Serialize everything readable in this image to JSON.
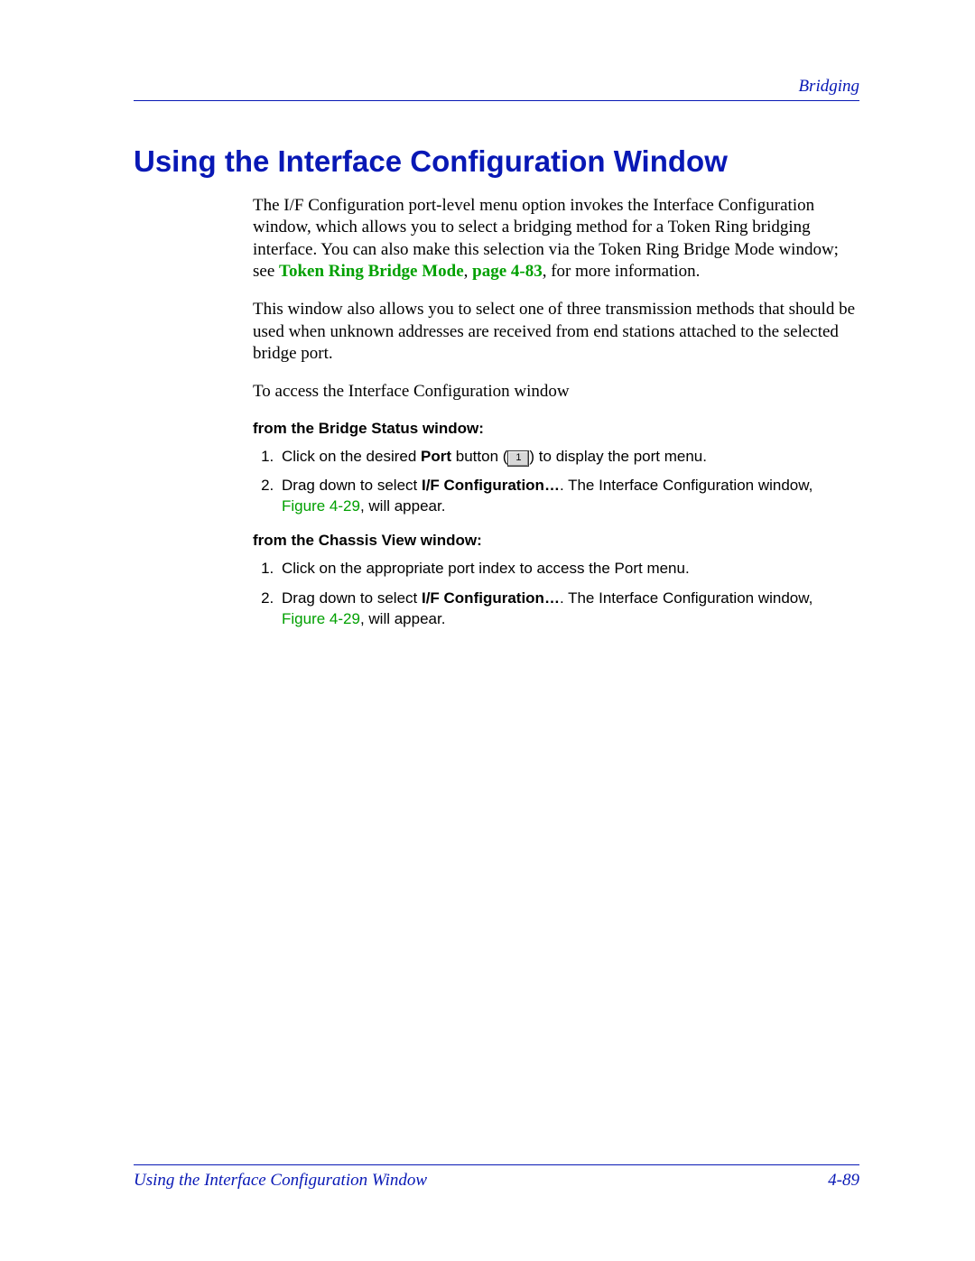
{
  "header": {
    "section_label": "Bridging"
  },
  "title": "Using the Interface Configuration Window",
  "paras": {
    "p1_a": "The I/F Configuration port-level menu option invokes the Interface Configuration window, which allows you to select a bridging method for a Token Ring bridging interface. You can also make this selection via the Token Ring Bridge Mode window; see ",
    "p1_link": "Token Ring Bridge Mode",
    "p1_b": ", ",
    "p1_page": "page 4-83",
    "p1_c": ", for more information.",
    "p2": "This window also allows you to select one of three transmission methods that should be used when unknown addresses are received from end stations attached to the selected bridge port.",
    "p3": "To access the Interface Configuration window"
  },
  "bridge_status": {
    "heading": "from the Bridge Status window:",
    "step1_a": "Click on the desired ",
    "step1_bold": "Port",
    "step1_b": " button (",
    "step1_btn": "1",
    "step1_c": ") to display the port menu.",
    "step2_a": "Drag down to select ",
    "step2_bold": "I/F Configuration…",
    "step2_b": ". The Interface Configuration window, ",
    "step2_fig": "Figure 4-29",
    "step2_c": ", will appear."
  },
  "chassis_view": {
    "heading": "from the Chassis View window:",
    "step1": "Click on the appropriate port index to access the Port menu.",
    "step2_a": "Drag down to select ",
    "step2_bold": "I/F Configuration…",
    "step2_b": ". The Interface Configuration window, ",
    "step2_fig": "Figure 4-29",
    "step2_c": ", will appear."
  },
  "footer": {
    "left": "Using the Interface Configuration Window",
    "right": "4-89"
  }
}
